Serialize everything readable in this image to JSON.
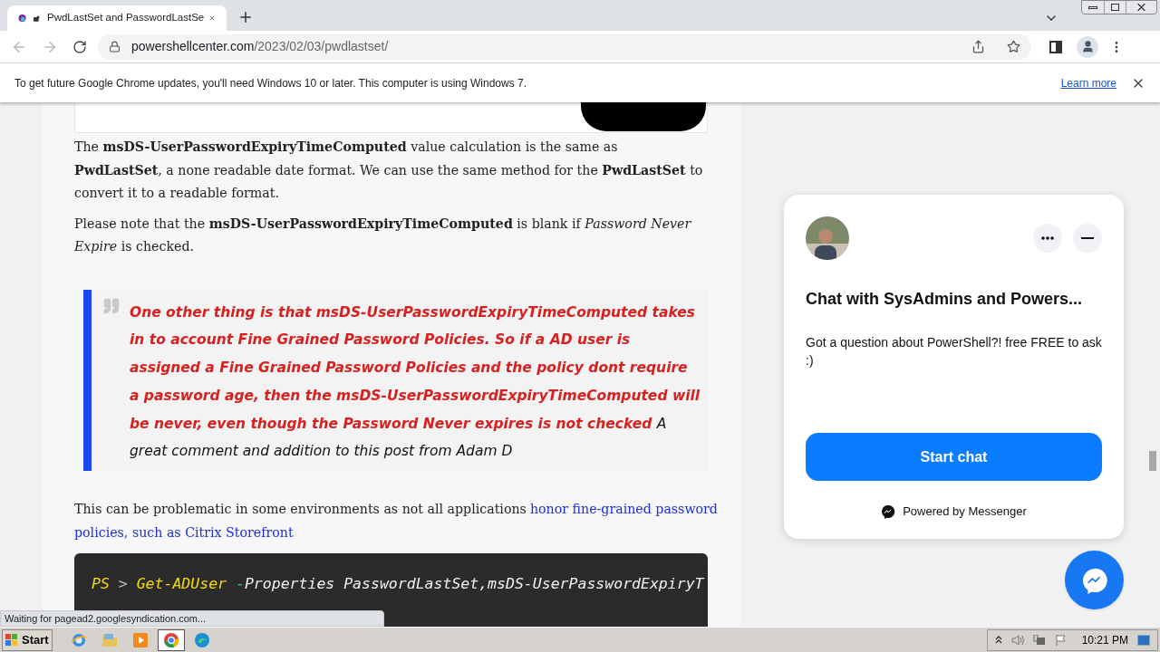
{
  "browser": {
    "tab": {
      "title": "PwdLastSet and PasswordLastSe",
      "selected": true
    },
    "url_host": "powershellcenter.com",
    "url_path": "/2023/02/03/pwdlastset/"
  },
  "infobar": {
    "message": "To get future Google Chrome updates, you'll need Windows 10 or later. This computer is using Windows 7.",
    "link": "Learn more"
  },
  "article": {
    "paragraphs": [
      "The **msDS-UserPasswordExpiryTimeComputed** value calculation is the same as **PwdLastSet**, a none readable date format. We can use the same method for the **PwdLastSet** to convert it to a readable format.",
      "Please note that the **msDS-UserPasswordExpiryTimeComputed** is blank if *Password Never Expire* is checked."
    ],
    "quote": [
      {
        "kind": "highlight",
        "text": "One other thing is that **msDS-UserPasswordExpiryTimeComputed** takes in to account Fine Grained Password Policies. So if a AD user is assigned a Fine Grained Password Policies and the policy dont require a password age, then the **msDS-UserPasswordExpiryTimeComputed** will be never, even though the Password Never expires is not checked"
      },
      {
        "kind": "plain",
        "text": "A great comment and addition to this post from Adam D"
      }
    ],
    "note": {
      "text": "This can be problematic in some environments as not all applications",
      "link_lines": [
        "honor fine-grained password",
        "policies, such as Citrix Storefront"
      ]
    },
    "code": [
      {
        "kind": "prompt",
        "text": "PS"
      },
      {
        "kind": "operator",
        "text": ">"
      },
      {
        "kind": "command",
        "text": "Get-ADUser"
      },
      {
        "kind": "param",
        "text": "-"
      },
      {
        "kind": "plain",
        "text": "Properties PasswordLastSet,msDS-UserPasswordExpiryT"
      }
    ]
  },
  "chat": {
    "title": "Chat with SysAdmins and Powers...",
    "message": "Got a question about PowerShell?! free FREE to ask :)",
    "button": "Start chat",
    "footer": "Powered by Messenger"
  },
  "status_bubble": "Waiting for pagead2.googlesyndication.com...",
  "taskbar": {
    "start": "Start",
    "apps": [
      {
        "kind": "ie",
        "selected": false
      },
      {
        "kind": "folder",
        "selected": false
      },
      {
        "kind": "media",
        "selected": false
      },
      {
        "kind": "chrome",
        "selected": true
      },
      {
        "kind": "edge",
        "selected": false
      }
    ],
    "time": "10:21 PM"
  }
}
